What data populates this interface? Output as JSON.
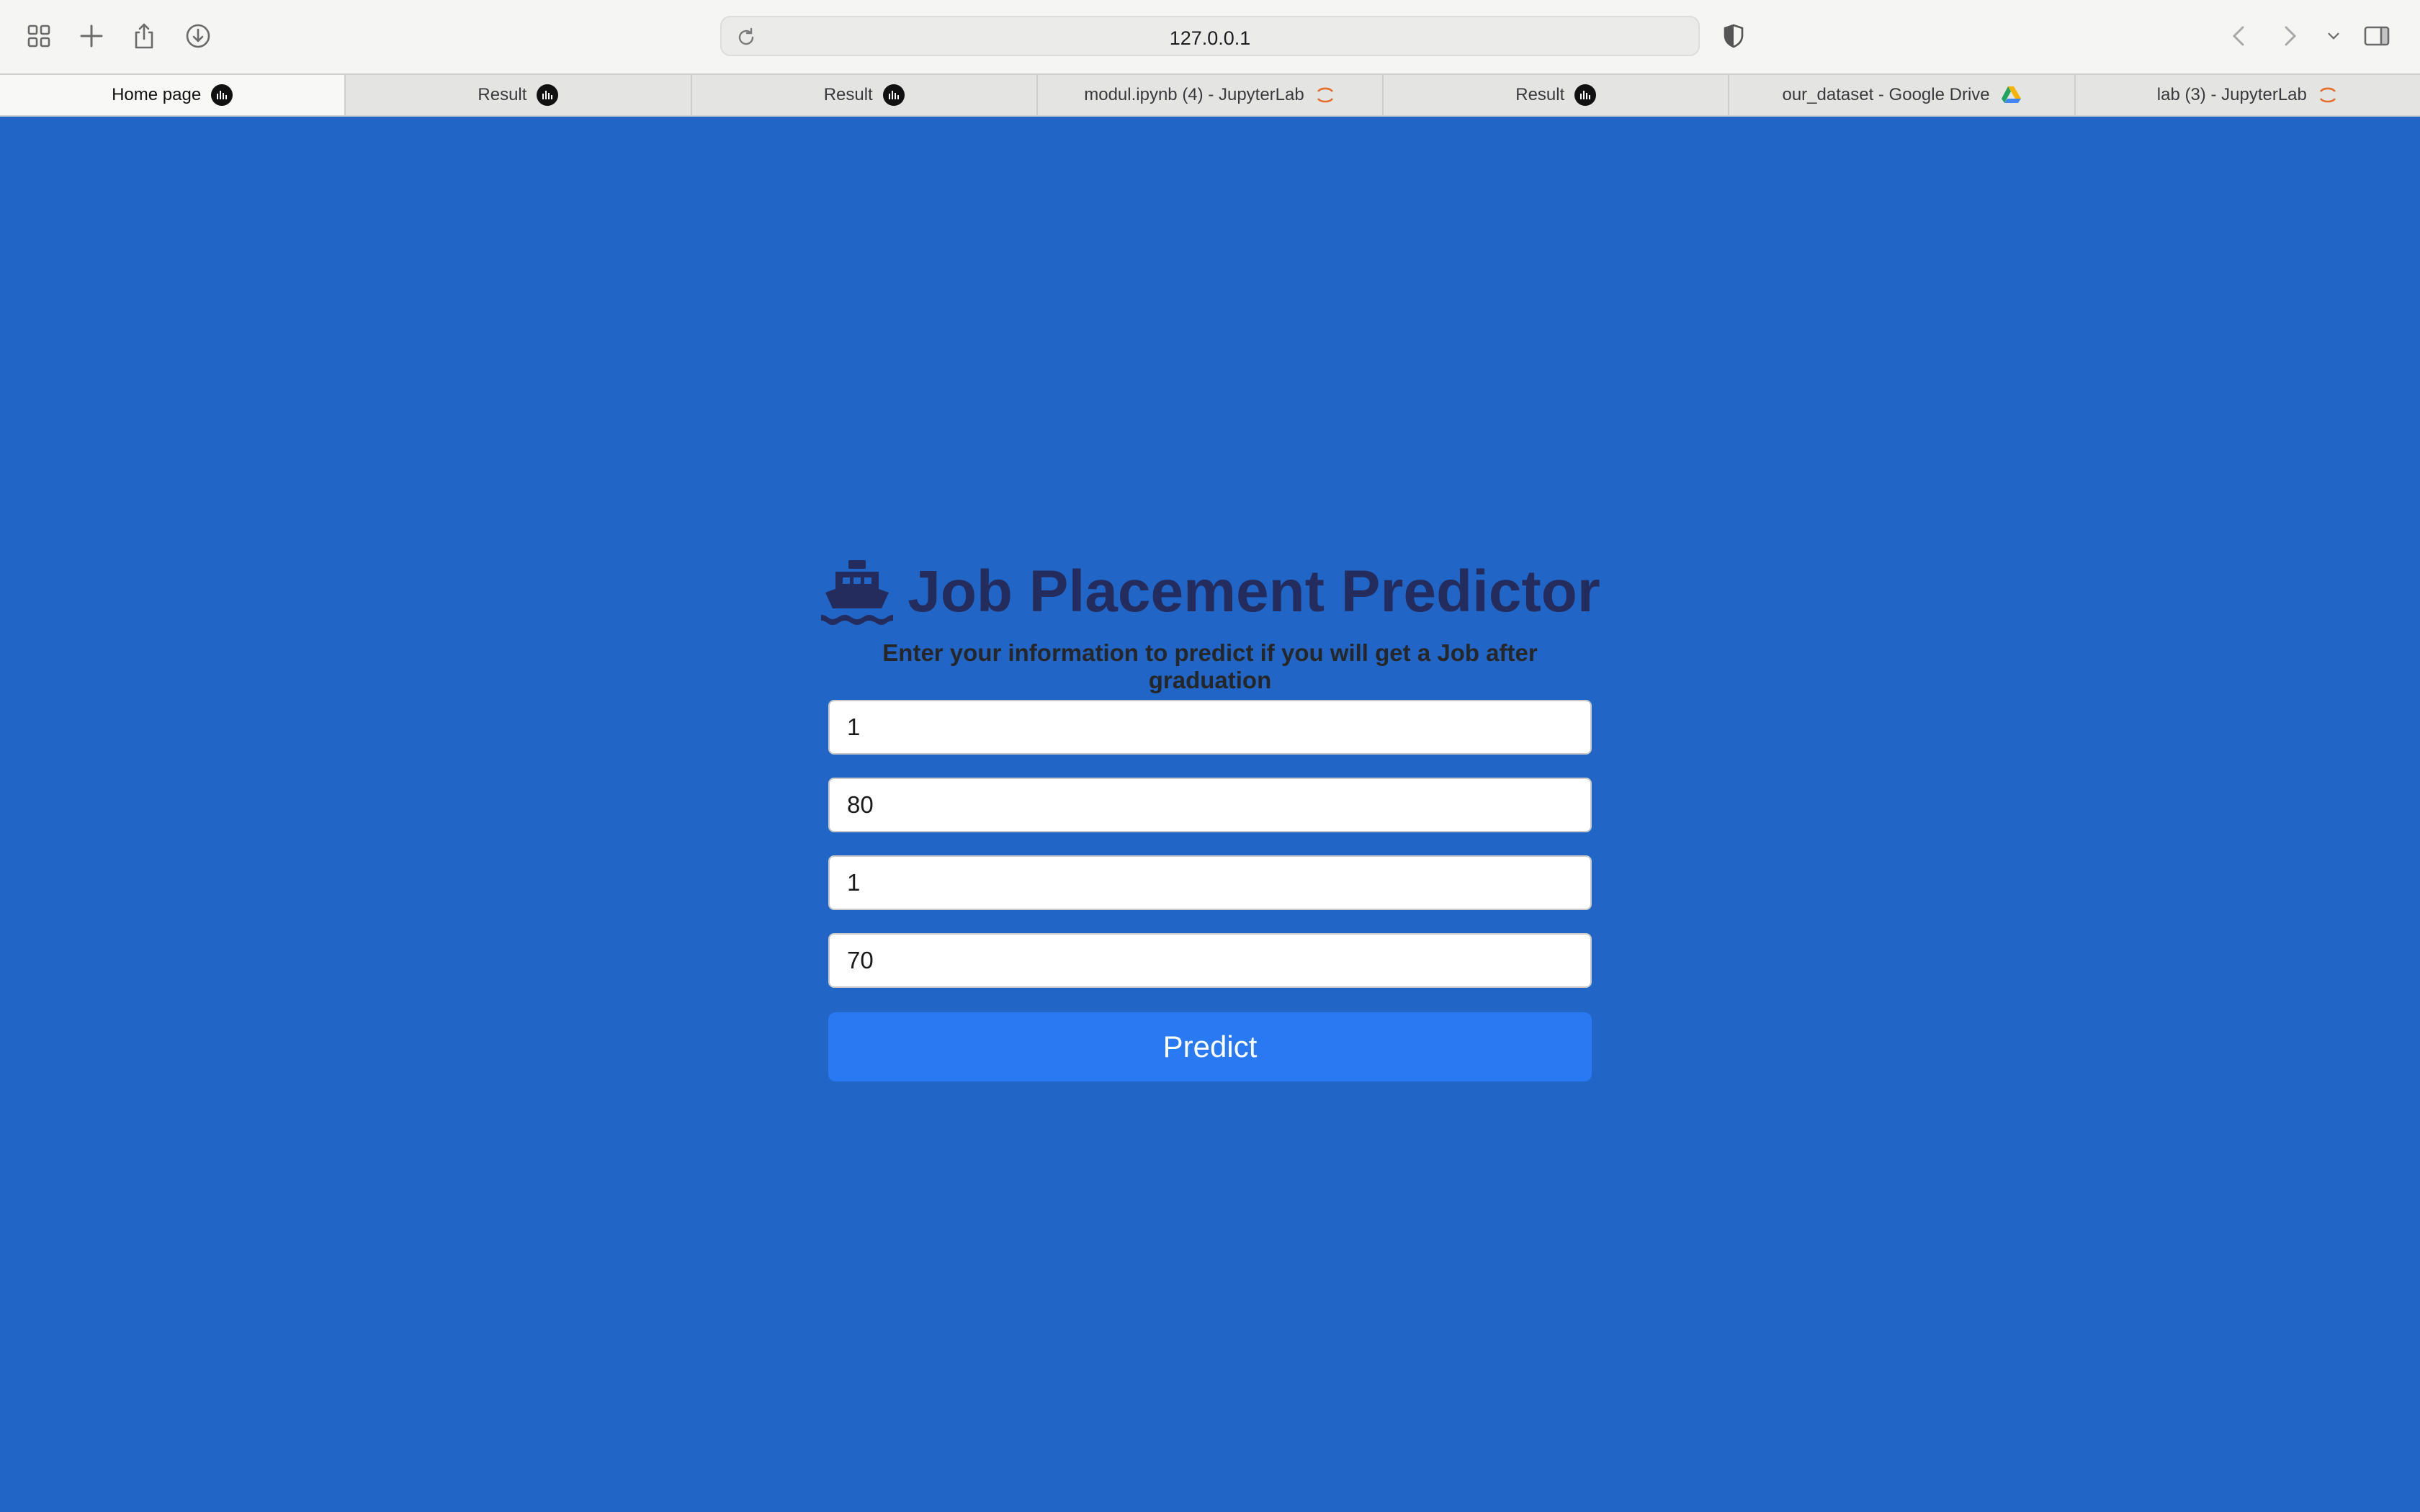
{
  "browser": {
    "address": "127.0.0.1",
    "icons": {
      "sidebar": "grid-icon",
      "new_tab": "plus-icon",
      "share": "share-icon",
      "downloads": "download-icon",
      "privacy": "shield-icon",
      "back": "chevron-left-icon",
      "forward": "chevron-right-icon",
      "tab_overview": "chevron-down-icon",
      "sidebar_right": "sidebar-icon"
    },
    "tabs": [
      {
        "label": "Home page",
        "icon": "chart-favicon"
      },
      {
        "label": "Result",
        "icon": "chart-favicon"
      },
      {
        "label": "Result",
        "icon": "chart-favicon"
      },
      {
        "label": "modul.ipynb (4) - JupyterLab",
        "icon": "jupyter-favicon"
      },
      {
        "label": "Result",
        "icon": "chart-favicon"
      },
      {
        "label": "our_dataset - Google Drive",
        "icon": "drive-favicon"
      },
      {
        "label": "lab (3) - JupyterLab",
        "icon": "jupyter-favicon"
      }
    ]
  },
  "page": {
    "title": "Job Placement Predictor",
    "title_icon": "ship-icon",
    "subtitle": "Enter your information to predict if you will get a Job after graduation",
    "fields": [
      {
        "value": "1"
      },
      {
        "value": "80"
      },
      {
        "value": "1"
      },
      {
        "value": "70"
      }
    ],
    "submit_label": "Predict",
    "colors": {
      "background": "#2166c6",
      "title": "#232c5c",
      "button": "#2979f2"
    }
  }
}
